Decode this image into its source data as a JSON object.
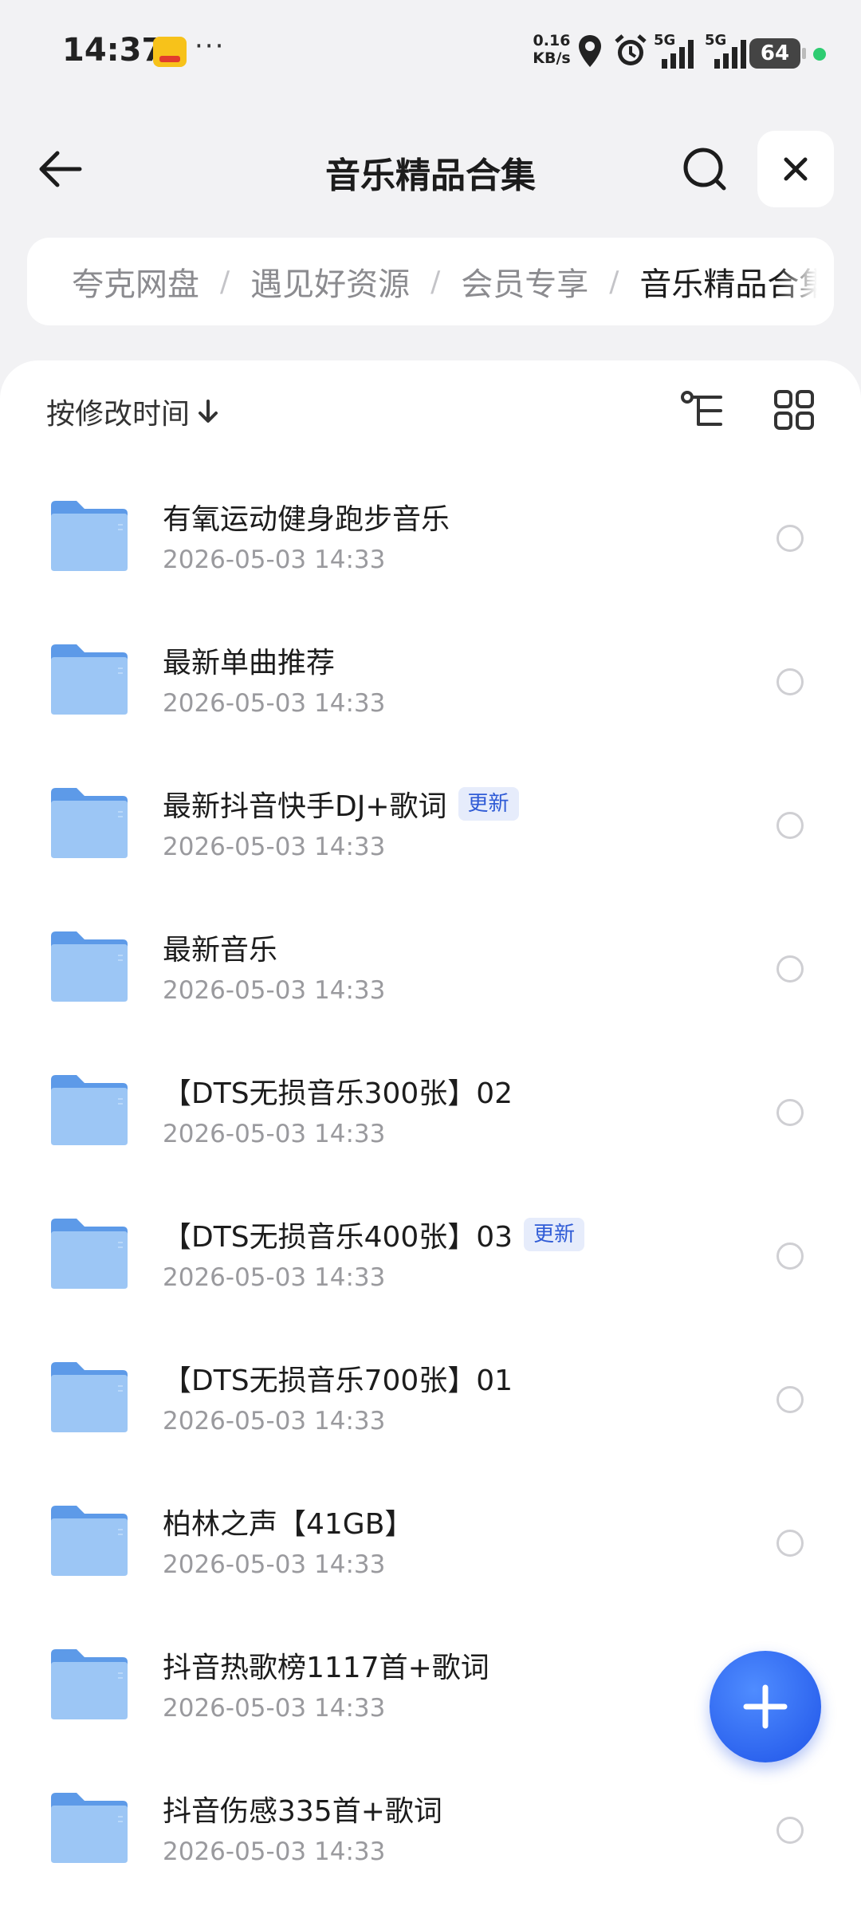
{
  "status_bar": {
    "time": "14:37",
    "net_speed_value": "0.16",
    "net_speed_unit": "KB/s",
    "network_1": "5G",
    "network_2": "5G",
    "battery": "64"
  },
  "header": {
    "title": "音乐精品合集"
  },
  "breadcrumb": {
    "items": [
      "夸克网盘",
      "遇见好资源",
      "会员专享",
      "音乐精品合集"
    ]
  },
  "toolbar": {
    "sort_label": "按修改时间"
  },
  "files": [
    {
      "name": "有氧运动健身跑步音乐",
      "date": "2026-05-03 14:33"
    },
    {
      "name": "最新单曲推荐",
      "date": "2026-05-03 14:33"
    },
    {
      "name": "最新抖音快手DJ+歌词",
      "date": "2026-05-03 14:33",
      "badge": "更新"
    },
    {
      "name": "最新音乐",
      "date": "2026-05-03 14:33"
    },
    {
      "name": "【DTS无损音乐300张】02",
      "date": "2026-05-03 14:33"
    },
    {
      "name": "【DTS无损音乐400张】03",
      "date": "2026-05-03 14:33",
      "badge": "更新"
    },
    {
      "name": "【DTS无损音乐700张】01",
      "date": "2026-05-03 14:33"
    },
    {
      "name": "柏林之声【41GB】",
      "date": "2026-05-03 14:33"
    },
    {
      "name": "抖音热歌榜1117首+歌词",
      "date": "2026-05-03 14:33"
    },
    {
      "name": "抖音伤感335首+歌词",
      "date": "2026-05-03 14:33"
    }
  ],
  "colors": {
    "accent": "#2a62f0",
    "folder": "#8dbcf4",
    "badge_bg": "#e6ecfb",
    "badge_text": "#2f5bd6"
  },
  "icons": {
    "back": "arrow-left-icon",
    "search": "search-icon",
    "close": "close-icon",
    "sort": "arrow-down-icon",
    "tree": "tree-view-icon",
    "grid": "grid-view-icon",
    "folder": "folder-icon",
    "add": "plus-icon"
  }
}
